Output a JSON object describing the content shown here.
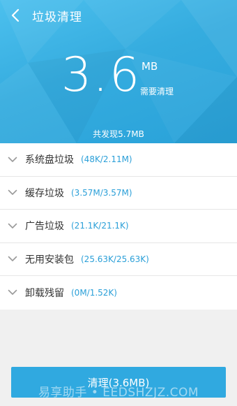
{
  "header": {
    "title": "垃圾清理",
    "back_icon": "chevron-left-icon"
  },
  "summary": {
    "size_value": "3.6",
    "size_unit": "MB",
    "need_clean_label": "需要清理",
    "found_text": "共发现5.7MB"
  },
  "categories": [
    {
      "label": "系统盘垃圾",
      "size": "(48K/2.11M)"
    },
    {
      "label": "缓存垃圾",
      "size": "(3.57M/3.57M)"
    },
    {
      "label": "广告垃圾",
      "size": "(21.1K/21.1K)"
    },
    {
      "label": "无用安装包",
      "size": "(25.63K/25.63K)"
    },
    {
      "label": "卸载残留",
      "size": "(0M/1.52K)"
    }
  ],
  "action": {
    "clean_button_label": "清理(3.6MB)"
  },
  "watermark": "易享助手 • EEDSHZJZ.COM",
  "colors": {
    "accent": "#30a9e0",
    "hero_blue": "#35acdf",
    "size_text": "#2a9fd8"
  }
}
